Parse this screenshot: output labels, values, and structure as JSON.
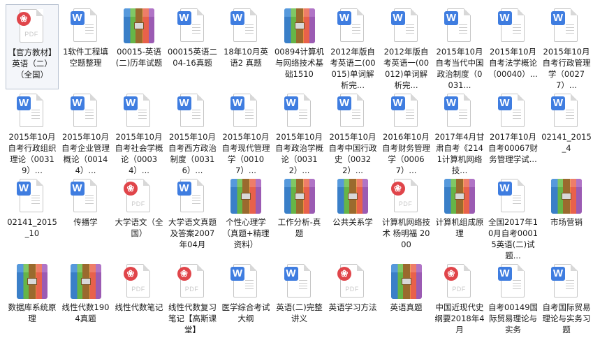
{
  "items": [
    {
      "type": "pdf",
      "label": "【官方教材】英语（二）（全国）",
      "selected": true
    },
    {
      "type": "word",
      "label": "1软件工程填空题整理"
    },
    {
      "type": "archive",
      "label": "00015-英语(二)历年试题"
    },
    {
      "type": "word",
      "label": "00015英语二04-16真题"
    },
    {
      "type": "word",
      "label": "18年10月英语2 真题"
    },
    {
      "type": "archive",
      "label": "00894计算机与网络技术基础1510"
    },
    {
      "type": "word",
      "label": "2012年版自考英语二(00015)单词解析完..."
    },
    {
      "type": "word",
      "label": "2012年版自考英语一(00012)单词解析完..."
    },
    {
      "type": "word",
      "label": "2015年10月自考当代中国政治制度（0031..."
    },
    {
      "type": "word",
      "label": "2015年10月自考法学概论（00040）..."
    },
    {
      "type": "word",
      "label": "2015年10月自考行政管理学（00277）..."
    },
    {
      "type": "word",
      "label": "2015年10月自考行政组织理论（00319）..."
    },
    {
      "type": "word",
      "label": "2015年10月自考企业管理概论（00144）..."
    },
    {
      "type": "word",
      "label": "2015年10月自考社会学概论（00034）..."
    },
    {
      "type": "word",
      "label": "2015年10月自考西方政治制度（00316）..."
    },
    {
      "type": "word",
      "label": "2015年10月自考现代管理学（00107）..."
    },
    {
      "type": "word",
      "label": "2015年10月自考政治学概论（00312）..."
    },
    {
      "type": "word",
      "label": "2015年10月自考中国行政史（00322）..."
    },
    {
      "type": "word",
      "label": "2016年10月自考财务管理学（00067）..."
    },
    {
      "type": "word",
      "label": "2017年4月甘肃自考《2141计算机网络技..."
    },
    {
      "type": "word",
      "label": "2017年10月自考00067财务管理学试..."
    },
    {
      "type": "word",
      "label": "02141_2015_4"
    },
    {
      "type": "word",
      "label": "02141_2015_10"
    },
    {
      "type": "word",
      "label": "传播学"
    },
    {
      "type": "pdf",
      "label": "大学语文（全国）"
    },
    {
      "type": "word",
      "label": "大学语文真题及答案2007年04月"
    },
    {
      "type": "archive",
      "label": "个性心理学（真题+精理资料）"
    },
    {
      "type": "archive",
      "label": "工作分析-真题"
    },
    {
      "type": "archive",
      "label": "公共关系学"
    },
    {
      "type": "pdf",
      "label": "计算机网络技术 杨明福 2000"
    },
    {
      "type": "archive",
      "label": "计算机组成原理"
    },
    {
      "type": "word",
      "label": "全国2017年10月自考00015英语(二)试题..."
    },
    {
      "type": "archive",
      "label": "市场营销"
    },
    {
      "type": "archive",
      "label": "数据库系统原理"
    },
    {
      "type": "archive",
      "label": "线性代数1904真题"
    },
    {
      "type": "pdf",
      "label": "线性代数笔记"
    },
    {
      "type": "pdf",
      "label": "线性代数复习笔记【高斯课堂】"
    },
    {
      "type": "word",
      "label": "医学综合考试大纲"
    },
    {
      "type": "word",
      "label": "英语(二)完整讲义"
    },
    {
      "type": "pdf",
      "label": "英语学习方法"
    },
    {
      "type": "archive",
      "label": "英语真题"
    },
    {
      "type": "pdf",
      "label": "中国近现代史纲要2018年4月"
    },
    {
      "type": "word",
      "label": "自考00149国际贸易理论与实务"
    },
    {
      "type": "word",
      "label": "自考国际贸易理论与实务习题"
    }
  ],
  "icons": {
    "word": "word-document-icon",
    "pdf": "pdf-document-icon",
    "archive": "winrar-archive-icon"
  },
  "icon_text": {
    "word": "W",
    "pdf": "PDF"
  },
  "colors": {
    "word": "#3f7de0",
    "pdf": "#e0454a",
    "selection": "#b9c3d1"
  }
}
